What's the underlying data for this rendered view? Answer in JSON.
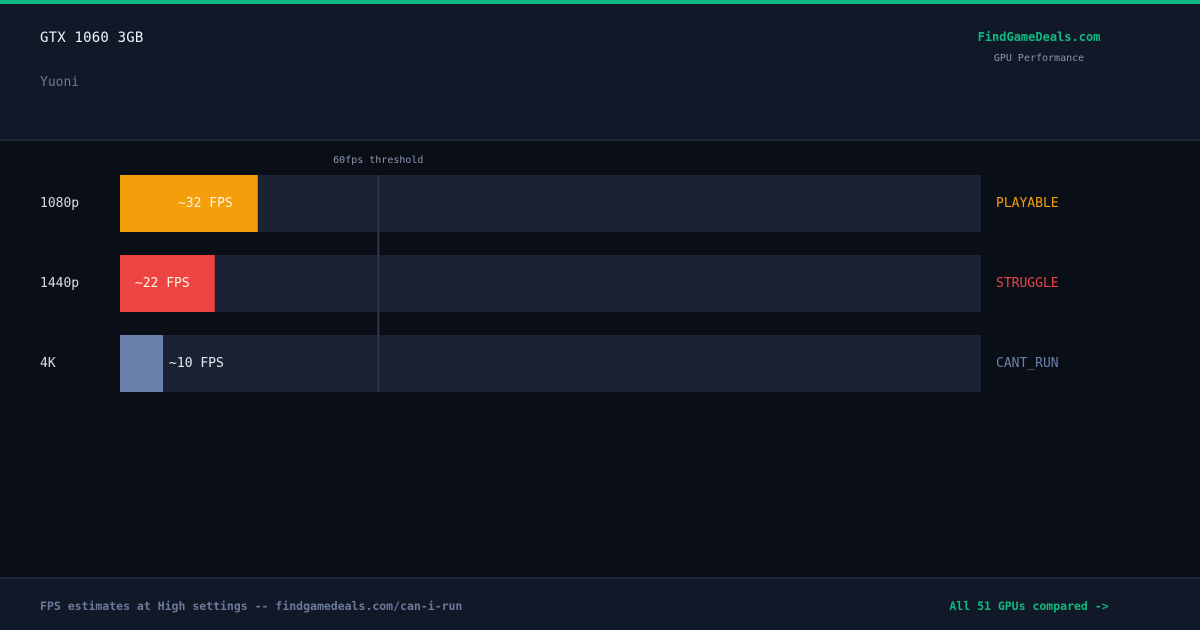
{
  "header": {
    "gpu": "GTX 1060 3GB",
    "game": "Yuoni",
    "brand": "FindGameDeals.com",
    "brand_sub": "GPU Performance"
  },
  "chart_data": {
    "type": "bar",
    "orientation": "horizontal",
    "categories": [
      "1080p",
      "1440p",
      "4K"
    ],
    "values": [
      32,
      22,
      10
    ],
    "value_labels": [
      "~32 FPS",
      "~22 FPS",
      "~10 FPS"
    ],
    "status": [
      "PLAYABLE",
      "STRUGGLE",
      "CANT_RUN"
    ],
    "colors": [
      "#f59e0b",
      "#ef4444",
      "#6b7fad"
    ],
    "status_colors": [
      "#f59e0b",
      "#ef4444",
      "#6b7fad"
    ],
    "threshold": {
      "value": 60,
      "label": "60fps threshold"
    },
    "xlim": [
      0,
      200
    ]
  },
  "footer": {
    "note": "FPS estimates at High settings -- findgamedeals.com/can-i-run",
    "link": "All 51 GPUs compared ->"
  },
  "colors": {
    "accent": "#10b981",
    "background": "#0a0e17",
    "panel": "#111827",
    "track": "#1a2234"
  }
}
